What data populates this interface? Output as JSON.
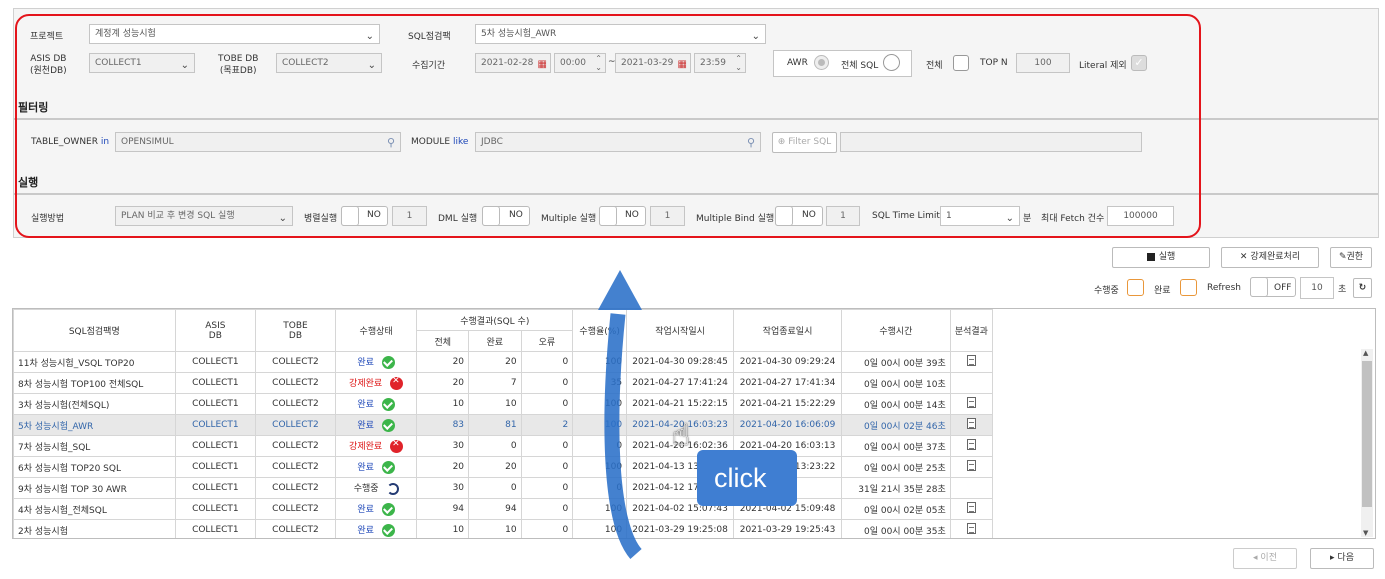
{
  "form": {
    "project_label": "프로젝트",
    "project_value": "계정계 성능시험",
    "sql_check_label": "SQL점검팩",
    "sql_check_value": "5차 성능시험_AWR",
    "asis_label1": "ASIS DB",
    "asis_label2": "(원천DB)",
    "asis_value": "COLLECT1",
    "tobe_label1": "TOBE DB",
    "tobe_label2": "(목표DB)",
    "tobe_value": "COLLECT2",
    "period_label": "수집기간",
    "start_date": "2021-02-28",
    "start_time": "00:00",
    "tilde": "~",
    "end_date": "2021-03-29",
    "end_time": "23:59",
    "awr_label": "AWR",
    "full_sql_label": "전체 SQL",
    "all_label": "전체",
    "topn_label": "TOP N",
    "topn_value": "100",
    "literal_label": "Literal 제외"
  },
  "filter": {
    "section": "필터링",
    "table_owner_label": "TABLE_OWNER",
    "in_label": "in",
    "table_owner_value": "OPENSIMUL",
    "module_label": "MODULE",
    "like_label": "like",
    "module_value": "JDBC",
    "filter_sql_label": "Filter SQL"
  },
  "exec": {
    "section": "실행",
    "method_label": "실행방법",
    "method_value": "PLAN 비교 후 변경 SQL 실행",
    "parallel_label": "병렬실행",
    "parallel_no": "NO",
    "parallel_num": "1",
    "dml_label": "DML 실행",
    "dml_no": "NO",
    "multiple_label": "Multiple 실행",
    "multiple_no": "NO",
    "multiple_num": "1",
    "mbind_label": "Multiple Bind 실행",
    "mbind_no": "NO",
    "mbind_num": "1",
    "timelimit_label": "SQL Time Limit",
    "timelimit_value": "1",
    "minute_label": "분",
    "fetch_label": "최대 Fetch 건수",
    "fetch_value": "100000"
  },
  "actions": {
    "run": "실행",
    "force": "강제완료처리",
    "auth": "권한"
  },
  "refresh_bar": {
    "running": "수행중",
    "done": "완료",
    "refresh": "Refresh",
    "off": "OFF",
    "interval": "10",
    "sec": "초"
  },
  "table": {
    "h_name": "SQL점검팩명",
    "h_asis1": "ASIS",
    "h_asis2": "DB",
    "h_tobe1": "TOBE",
    "h_tobe2": "DB",
    "h_state": "수행상태",
    "h_result": "수행결과(SQL 수)",
    "h_total": "전체",
    "h_done": "완료",
    "h_err": "오류",
    "h_rate": "수행율(%)",
    "h_start": "작업시작일시",
    "h_end": "작업종료일시",
    "h_time": "수행시간",
    "h_analysis": "분석결과",
    "rows": [
      {
        "name": "11차 성능시험_VSQL TOP20",
        "asis": "COLLECT1",
        "tobe": "COLLECT2",
        "state": "완료",
        "st": "ok",
        "total": "20",
        "done": "20",
        "err": "0",
        "rate": "100",
        "start": "2021-04-30 09:28:45",
        "end": "2021-04-30 09:29:24",
        "time": "0일 00시 00분 39초",
        "doc": true
      },
      {
        "name": "8차 성능시험 TOP100 전체SQL",
        "asis": "COLLECT1",
        "tobe": "COLLECT2",
        "state": "강제완료",
        "st": "err",
        "total": "20",
        "done": "7",
        "err": "0",
        "rate": "35",
        "start": "2021-04-27 17:41:24",
        "end": "2021-04-27 17:41:34",
        "time": "0일 00시 00분 10초",
        "doc": false
      },
      {
        "name": "3차 성능시험(전체SQL)",
        "asis": "COLLECT1",
        "tobe": "COLLECT2",
        "state": "완료",
        "st": "ok",
        "total": "10",
        "done": "10",
        "err": "0",
        "rate": "100",
        "start": "2021-04-21 15:22:15",
        "end": "2021-04-21 15:22:29",
        "time": "0일 00시 00분 14초",
        "doc": true
      },
      {
        "name": "5차 성능시험_AWR",
        "asis": "COLLECT1",
        "tobe": "COLLECT2",
        "state": "완료",
        "st": "ok",
        "total": "83",
        "done": "81",
        "err": "2",
        "rate": "100",
        "start": "2021-04-20 16:03:23",
        "end": "2021-04-20 16:06:09",
        "time": "0일 00시 02분 46초",
        "doc": true,
        "sel": true
      },
      {
        "name": "7차 성능시험_SQL",
        "asis": "COLLECT1",
        "tobe": "COLLECT2",
        "state": "강제완료",
        "st": "err",
        "total": "30",
        "done": "0",
        "err": "0",
        "rate": "0",
        "start": "2021-04-20 16:02:36",
        "end": "2021-04-20 16:03:13",
        "time": "0일 00시 00분 37초",
        "doc": true
      },
      {
        "name": "6차 성능시험 TOP20 SQL",
        "asis": "COLLECT1",
        "tobe": "COLLECT2",
        "state": "완료",
        "st": "ok",
        "total": "20",
        "done": "20",
        "err": "0",
        "rate": "100",
        "start": "2021-04-13 13:21:57",
        "end": "2021-04-13 13:23:22",
        "time": "0일 00시 00분 25초",
        "doc": true
      },
      {
        "name": "9차 성능시험 TOP 30 AWR",
        "asis": "COLLECT1",
        "tobe": "COLLECT2",
        "state": "수행중",
        "st": "run",
        "total": "30",
        "done": "0",
        "err": "0",
        "rate": "0",
        "start": "2021-04-12 17:24:43",
        "end": "",
        "time": "31일 21시 35분 28초",
        "doc": false
      },
      {
        "name": "4차 성능시험_전체SQL",
        "asis": "COLLECT1",
        "tobe": "COLLECT2",
        "state": "완료",
        "st": "ok",
        "total": "94",
        "done": "94",
        "err": "0",
        "rate": "100",
        "start": "2021-04-02 15:07:43",
        "end": "2021-04-02 15:09:48",
        "time": "0일 00시 02분 05초",
        "doc": true
      },
      {
        "name": "2차 성능시험",
        "asis": "COLLECT1",
        "tobe": "COLLECT2",
        "state": "완료",
        "st": "ok",
        "total": "10",
        "done": "10",
        "err": "0",
        "rate": "100",
        "start": "2021-03-29 19:25:08",
        "end": "2021-03-29 19:25:43",
        "time": "0일 00시 00분 35초",
        "doc": true
      }
    ]
  },
  "pager": {
    "prev": "이전",
    "next": "다음"
  },
  "overlay": {
    "click_text": "click"
  }
}
